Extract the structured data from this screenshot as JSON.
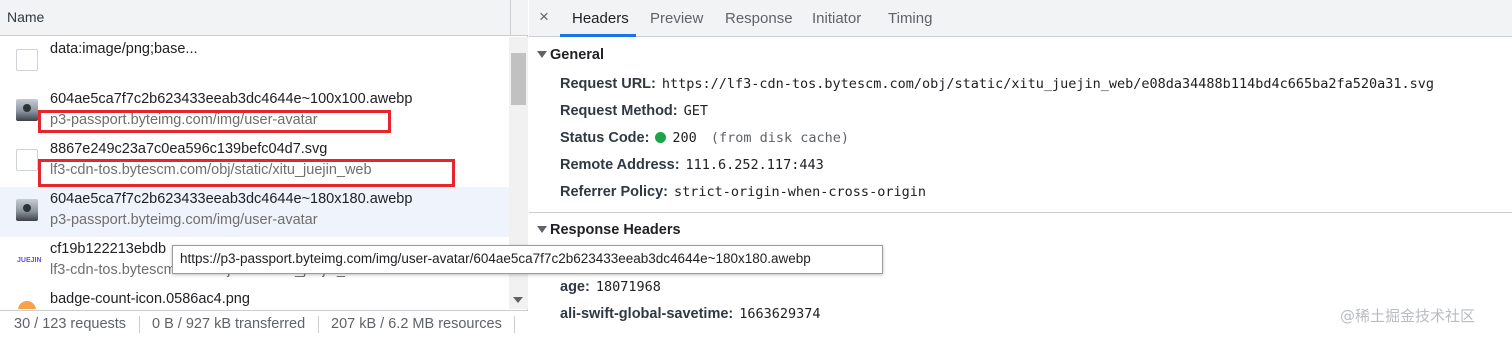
{
  "left": {
    "column_header": "Name",
    "requests": [
      {
        "name": "data:image/png;base...",
        "domain": "",
        "icon": "blank-file-icon"
      },
      {
        "name": "604ae5ca7f7c2b623433eeab3dc4644e~100x100.awebp",
        "domain": "p3-passport.byteimg.com/img/user-avatar",
        "icon": "avatar-thumbnail-icon"
      },
      {
        "name": "8867e249c23a7c0ea596c139befc04d7.svg",
        "domain": "lf3-cdn-tos.bytescm.com/obj/static/xitu_juejin_web",
        "icon": "blank-file-icon"
      },
      {
        "name": "604ae5ca7f7c2b623433eeab3dc4644e~180x180.awebp",
        "domain": "p3-passport.byteimg.com/img/user-avatar",
        "icon": "avatar-thumbnail-icon"
      },
      {
        "name": "cf19b122213ebdb",
        "domain": "lf3-cdn-tos.bytescm.com/obj/static/xitu_juejin_web",
        "icon": "juejin-logo-icon"
      },
      {
        "name": "badge-count-icon.0586ac4.png",
        "domain": "",
        "icon": "badge-icon"
      }
    ],
    "tooltip": "https://p3-passport.byteimg.com/img/user-avatar/604ae5ca7f7c2b623433eeab3dc4644e~180x180.awebp",
    "status": {
      "requests": "30 / 123 requests",
      "transferred": "0 B / 927 kB transferred",
      "resources": "207 kB / 6.2 MB resources"
    }
  },
  "right": {
    "close_glyph": "×",
    "tabs": [
      "Headers",
      "Preview",
      "Response",
      "Initiator",
      "Timing"
    ],
    "active_tab": "Headers",
    "general": {
      "title": "General",
      "rows": [
        {
          "key": "Request URL:",
          "value": "https://lf3-cdn-tos.bytescm.com/obj/static/xitu_juejin_web/e08da34488b114bd4c665ba2fa520a31.svg"
        },
        {
          "key": "Request Method:",
          "value": "GET"
        },
        {
          "key": "Status Code:",
          "value": "200",
          "note": "(from disk cache)"
        },
        {
          "key": "Remote Address:",
          "value": "111.6.252.117:443"
        },
        {
          "key": "Referrer Policy:",
          "value": "strict-origin-when-cross-origin"
        }
      ]
    },
    "response_headers": {
      "title": "Response Headers",
      "rows": [
        {
          "key": "age:",
          "value": "18071968"
        },
        {
          "key": "ali-swift-global-savetime:",
          "value": "1663629374"
        }
      ]
    }
  },
  "watermark": "@稀土掘金技术社区",
  "colors": {
    "highlight_box": "#e5262e",
    "tab_accent": "#1a73e8",
    "status_ok": "#1ea446",
    "selected_row": "#eef3fc"
  }
}
